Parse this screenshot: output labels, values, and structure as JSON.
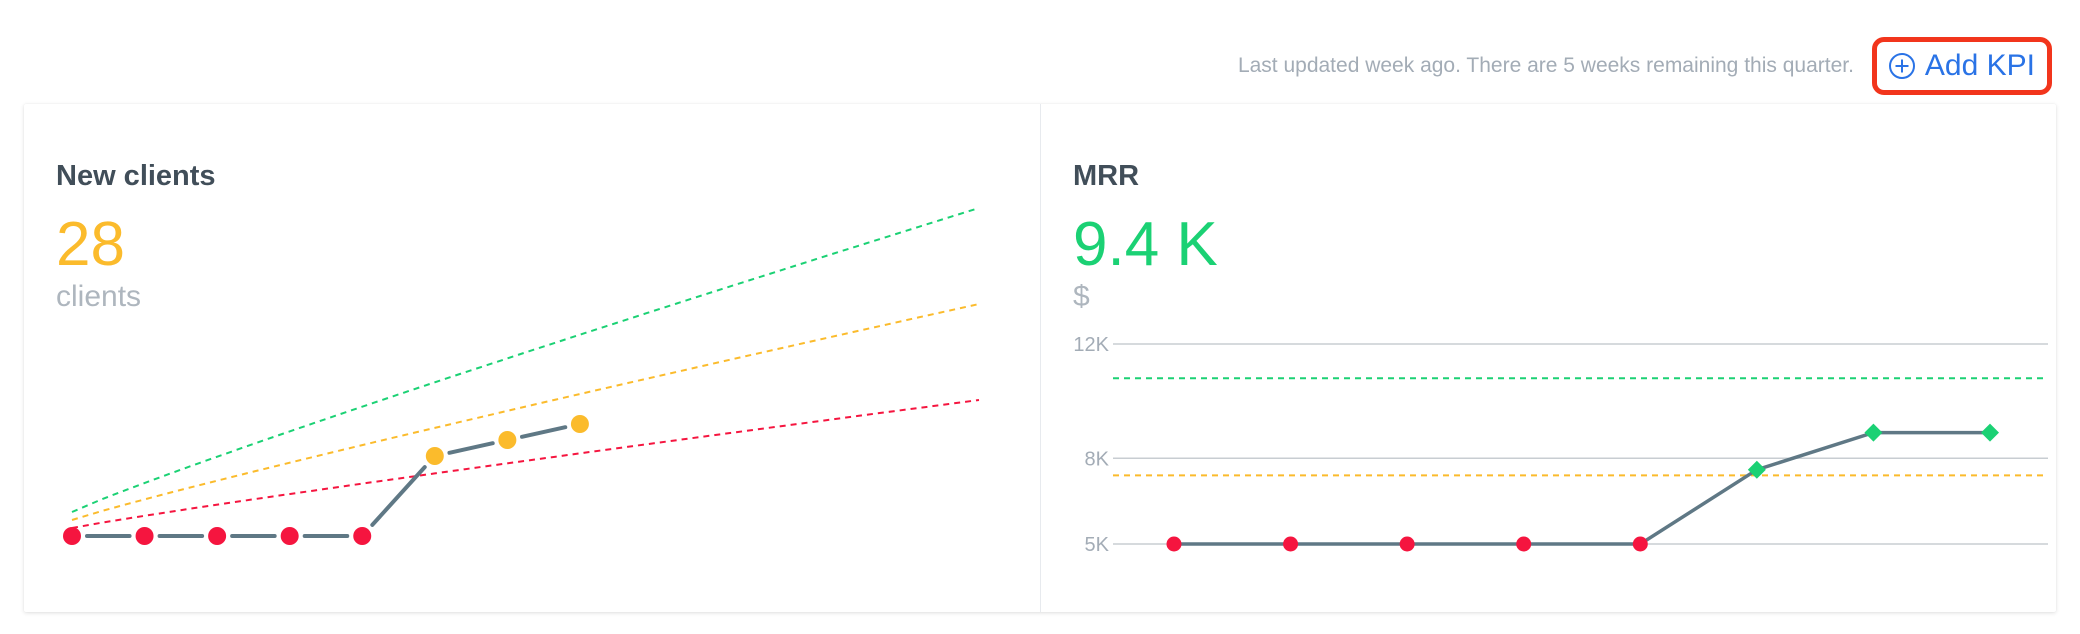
{
  "header": {
    "last_updated": "Last updated week ago. There are 5 weeks remaining this quarter.",
    "add_kpi_label": "Add KPI"
  },
  "colors": {
    "red": "#f5153f",
    "yellow": "#fbbb2c",
    "green": "#1bd174",
    "line": "#5f7885",
    "grid": "#c8cdd2",
    "accent_blue": "#2a73e6",
    "highlight": "#f2351c"
  },
  "kpis": [
    {
      "title": "New clients",
      "value": "28",
      "value_color": "#fbbb2c",
      "unit": "clients"
    },
    {
      "title": "MRR",
      "value": "9.4 K",
      "value_color": "#1bd174",
      "unit": "$"
    }
  ],
  "chart_data": [
    {
      "type": "line",
      "series": [
        {
          "x": [
            1,
            2,
            3,
            4,
            5,
            6,
            7,
            8
          ],
          "values": [
            1,
            1,
            1,
            1,
            1,
            11,
            13,
            15
          ],
          "point_colors": [
            "red",
            "red",
            "red",
            "red",
            "red",
            "yellow",
            "yellow",
            "yellow"
          ],
          "marker": "circle"
        }
      ],
      "target_lines": [
        {
          "color": "green",
          "start": 4,
          "end": 42
        },
        {
          "color": "yellow",
          "start": 3,
          "end": 30
        },
        {
          "color": "red",
          "start": 2,
          "end": 18
        }
      ],
      "x_range": [
        1,
        13.5
      ],
      "ylim": [
        0,
        50
      ]
    },
    {
      "type": "line",
      "series": [
        {
          "x": [
            1,
            2,
            3,
            4,
            5,
            6,
            7,
            8
          ],
          "values": [
            5000,
            5000,
            5000,
            5000,
            5000,
            7600,
            8900,
            8900
          ],
          "point_colors": [
            "red",
            "red",
            "red",
            "red",
            "red",
            "green",
            "green",
            "green"
          ],
          "marker": "mixed"
        }
      ],
      "target_lines": [
        {
          "color": "green",
          "value": 10800
        },
        {
          "color": "yellow",
          "value": 7400
        }
      ],
      "y_ticks": [
        {
          "value": 12000,
          "label": "12K"
        },
        {
          "value": 8000,
          "label": "8K"
        },
        {
          "value": 5000,
          "label": "5K"
        }
      ],
      "ylim": [
        5000,
        12000
      ]
    }
  ]
}
